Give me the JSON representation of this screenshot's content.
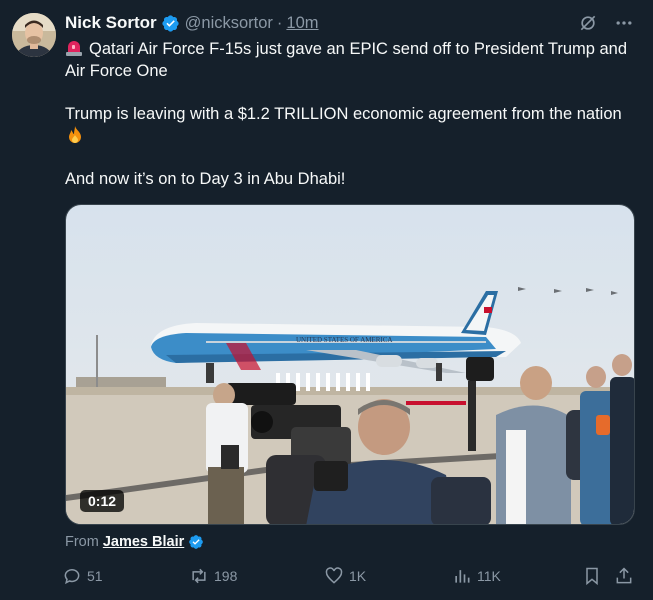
{
  "tweet": {
    "author": {
      "display_name": "Nick Sortor",
      "handle": "@nicksortor",
      "verified": true,
      "avatar_icon": "avatar"
    },
    "separator": "·",
    "time": "10m",
    "header_icons": [
      "grok-icon",
      "more-icon"
    ],
    "text": {
      "line1": "Qatari Air Force F-15s just gave an EPIC send off to President Trump and Air Force One",
      "line1_icon": "siren-icon",
      "line2": "Trump is leaving with a $1.2 TRILLION economic agreement from the nation",
      "line2_icon": "fire-icon",
      "line3": "And now it’s on to Day 3 in Abu Dhabi!"
    },
    "media": {
      "type": "video",
      "duration": "0:12",
      "aircraft_lettering": "UNITED STATES OF AMERICA"
    },
    "attribution": {
      "label": "From",
      "name": "James Blair",
      "verified": true
    },
    "actions": {
      "replies": "51",
      "reposts": "198",
      "likes": "1K",
      "views": "11K"
    }
  },
  "colors": {
    "background": "#15202b",
    "text": "#f7f9f9",
    "secondary": "#8b98a5",
    "verified": "#1d9bf0",
    "border": "#38444d"
  }
}
